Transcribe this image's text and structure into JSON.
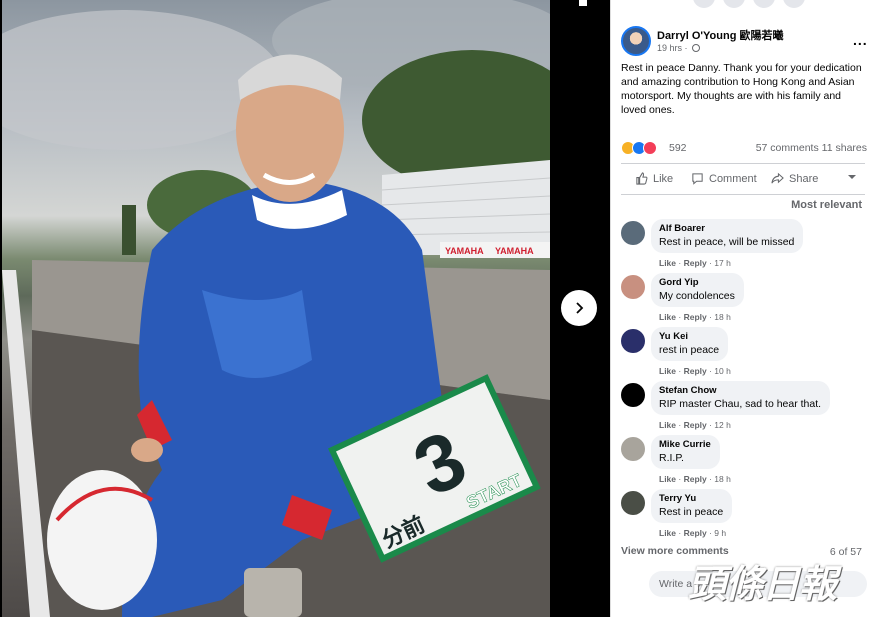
{
  "post": {
    "author": "Darryl O'Young 歐陽若曦",
    "time": "19 hrs ·",
    "text": "Rest in peace Danny. Thank you for your dedication and amazing contribution to Hong Kong and Asian motorsport. My thoughts are with his family and loved ones.",
    "more_icon": "..."
  },
  "reactions": {
    "count": "592",
    "comments": "57 comments",
    "shares": "11 shares"
  },
  "actions": {
    "like": "Like",
    "comment": "Comment",
    "share": "Share"
  },
  "sort": {
    "label": "Most relevant"
  },
  "comments": [
    {
      "name": "Alf Boarer",
      "text": "Rest in peace, will be missed",
      "like": "Like",
      "reply": "Reply",
      "age": "17 h",
      "avatar_color": "#5a6b7a"
    },
    {
      "name": "Gord Yip",
      "text": "My condolences",
      "like": "Like",
      "reply": "Reply",
      "age": "18 h",
      "avatar_color": "#c89080"
    },
    {
      "name": "Yu Kei",
      "text": "rest in peace",
      "like": "Like",
      "reply": "Reply",
      "age": "10 h",
      "avatar_color": "#2a2f6a"
    },
    {
      "name": "Stefan Chow",
      "text": "RIP master Chau, sad to hear that.",
      "like": "Like",
      "reply": "Reply",
      "age": "12 h",
      "avatar_color": "#000000"
    },
    {
      "name": "Mike Currie",
      "text": "R.I.P.",
      "like": "Like",
      "reply": "Reply",
      "age": "18 h",
      "avatar_color": "#a8a49c"
    },
    {
      "name": "Terry Yu",
      "text": "Rest in peace",
      "like": "Like",
      "reply": "Reply",
      "age": "9 h",
      "avatar_color": "#4a4e46"
    }
  ],
  "view_more": {
    "label": "View more comments",
    "count": "6 of 57"
  },
  "write_comment": {
    "placeholder": "Write a c"
  },
  "watermark": {
    "text": "頭條日報"
  },
  "photo": {
    "sign_number": "3",
    "sign_text": "START",
    "sign_chinese": "分前",
    "banner_text": "YAMAHA"
  }
}
